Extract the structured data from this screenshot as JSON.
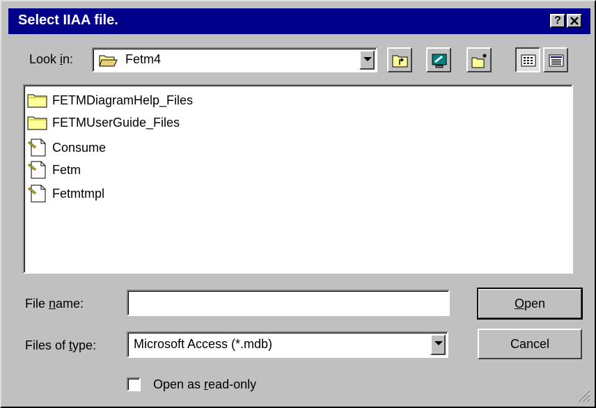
{
  "window": {
    "title": "Select IIAA file.",
    "help_label": "?",
    "close_label": "✕"
  },
  "lookin": {
    "label_prefix": "Look ",
    "label_underline": "i",
    "label_suffix": "n:",
    "value": "Fetm4"
  },
  "toolbar": {
    "icons": [
      "up-one-level-icon",
      "desktop-icon",
      "new-folder-icon",
      "list-view-icon",
      "details-view-icon"
    ]
  },
  "files": [
    {
      "name": "FETMDiagramHelp_Files",
      "icon": "folder-icon"
    },
    {
      "name": "FETMUserGuide_Files",
      "icon": "folder-icon"
    },
    {
      "name": "Consume",
      "icon": "access-file-icon"
    },
    {
      "name": "Fetm",
      "icon": "access-file-icon"
    },
    {
      "name": "Fetmtmpl",
      "icon": "access-file-icon"
    }
  ],
  "filename": {
    "label_prefix": "File ",
    "label_underline": "n",
    "label_suffix": "ame:",
    "value": ""
  },
  "filetype": {
    "label_prefix": "Files of ",
    "label_underline": "t",
    "label_suffix": "ype:",
    "value": "Microsoft Access (*.mdb)"
  },
  "buttons": {
    "open_underline": "O",
    "open_rest": "pen",
    "cancel": "Cancel"
  },
  "readonly": {
    "label_prefix": "Open as ",
    "label_underline": "r",
    "label_suffix": "ead-only",
    "checked": false
  },
  "colors": {
    "titlebar": "#00008b",
    "face": "#c0c0c0",
    "folder": "#ffff99"
  }
}
